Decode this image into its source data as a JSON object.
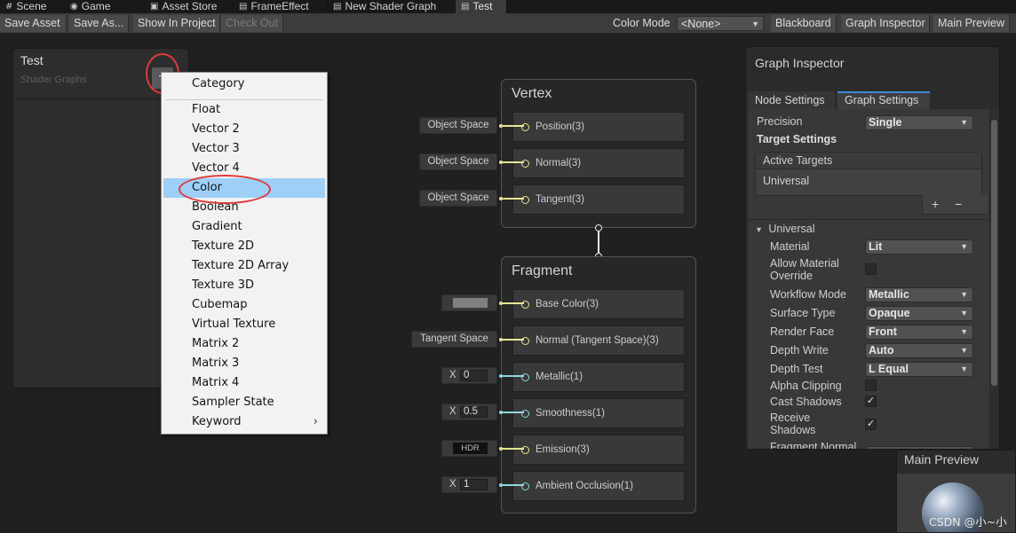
{
  "tabs": [
    {
      "label": "Scene",
      "icon": "hash-icon"
    },
    {
      "label": "Game",
      "icon": "gamepad-icon"
    },
    {
      "label": "Asset Store",
      "icon": "store-icon"
    },
    {
      "label": "FrameEffect",
      "icon": "graph-icon"
    },
    {
      "label": "New Shader Graph",
      "icon": "graph-icon"
    },
    {
      "label": "Test",
      "icon": "graph-icon"
    }
  ],
  "toolbar": {
    "save_asset": "Save Asset",
    "save_as": "Save As...",
    "show_in_project": "Show In Project",
    "check_out": "Check Out",
    "color_mode_label": "Color Mode",
    "color_mode_value": "<None>",
    "blackboard": "Blackboard",
    "graph_inspector": "Graph Inspector",
    "main_preview": "Main Preview"
  },
  "blackboard": {
    "title": "Test",
    "subtitle": "Shader Graphs",
    "add_glyph": "+"
  },
  "menu": {
    "items": [
      "Category",
      "Float",
      "Vector 2",
      "Vector 3",
      "Vector 4",
      "Color",
      "Boolean",
      "Gradient",
      "Texture 2D",
      "Texture 2D Array",
      "Texture 3D",
      "Cubemap",
      "Virtual Texture",
      "Matrix 2",
      "Matrix 3",
      "Matrix 4",
      "Sampler State",
      "Keyword"
    ],
    "highlighted": "Color",
    "submenu_arrow": "›"
  },
  "vertex": {
    "title": "Vertex",
    "blocks": [
      {
        "label": "Position(3)",
        "input": "Object Space"
      },
      {
        "label": "Normal(3)",
        "input": "Object Space"
      },
      {
        "label": "Tangent(3)",
        "input": "Object Space"
      }
    ]
  },
  "fragment": {
    "title": "Fragment",
    "blocks": [
      {
        "label": "Base Color(3)",
        "swatch": "#808080"
      },
      {
        "label": "Normal (Tangent Space)(3)",
        "input": "Tangent Space"
      },
      {
        "label": "Metallic(1)",
        "axis": "X",
        "value": "0"
      },
      {
        "label": "Smoothness(1)",
        "axis": "X",
        "value": "0.5"
      },
      {
        "label": "Emission(3)",
        "input": "HDR"
      },
      {
        "label": "Ambient Occlusion(1)",
        "axis": "X",
        "value": "1"
      }
    ]
  },
  "inspector": {
    "title": "Graph Inspector",
    "tabs": [
      "Node Settings",
      "Graph Settings"
    ],
    "active_tab": "Graph Settings",
    "precision_label": "Precision",
    "precision_value": "Single",
    "target_settings": "Target Settings",
    "active_targets": "Active Targets",
    "target_item": "Universal",
    "add_glyph": "+",
    "remove_glyph": "−",
    "universal_header": "Universal",
    "settings": [
      {
        "label": "Material",
        "value": "Lit"
      },
      {
        "label": "Allow Material\nOverride",
        "checked": false
      },
      {
        "label": "Workflow Mode",
        "value": "Metallic"
      },
      {
        "label": "Surface Type",
        "value": "Opaque"
      },
      {
        "label": "Render Face",
        "value": "Front"
      },
      {
        "label": "Depth Write",
        "value": "Auto"
      },
      {
        "label": "Depth Test",
        "value": "L Equal"
      },
      {
        "label": "Alpha Clipping",
        "checked": false
      },
      {
        "label": "Cast Shadows",
        "checked": true
      },
      {
        "label": "Receive\nShadows",
        "checked": true
      },
      {
        "label": "Fragment Normal",
        "value": ""
      }
    ]
  },
  "preview": {
    "title": "Main Preview"
  },
  "watermark": "CSDN @小~小",
  "colors": {
    "background": "#202020",
    "highlight": "#9ed0f7",
    "annotation": "#e03a3a",
    "port_yellow": "#e5e595",
    "port_cyan": "#8ed8e0",
    "tab_accent": "#3d8bd9"
  }
}
